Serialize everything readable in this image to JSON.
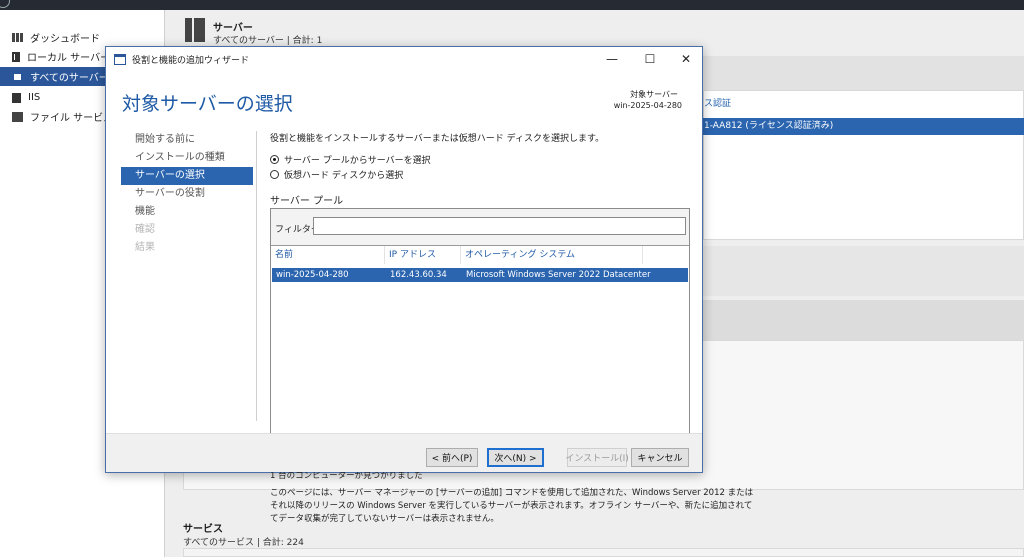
{
  "sidebar": {
    "items": [
      {
        "label": "ダッシュボード",
        "icon": "dashboard-icon"
      },
      {
        "label": "ローカル サーバー",
        "icon": "local-server-icon"
      },
      {
        "label": "すべてのサーバー",
        "icon": "all-servers-icon",
        "active": true
      },
      {
        "label": "IIS",
        "icon": "iis-icon"
      },
      {
        "label": "ファイル サービスと",
        "icon": "file-services-icon"
      }
    ]
  },
  "main": {
    "servers_title": "サーバー",
    "servers_sub": "すべてのサーバー | 合計: 1",
    "activation_link": "ス認証",
    "server_row": "1-AA812 (ライセンス認証済み)",
    "services_title": "サービス",
    "services_sub": "すべてのサービス | 合計: 224"
  },
  "wizard": {
    "window_title": "役割と機能の追加ウィザード",
    "controls": {
      "minimize": "—",
      "maximize": "☐",
      "close": "✕"
    },
    "heading": "対象サーバーの選択",
    "destination_label": "対象サーバー",
    "destination_name": "win-2025-04-280",
    "nav": [
      {
        "label": "開始する前に",
        "state": "normal"
      },
      {
        "label": "インストールの種類",
        "state": "normal"
      },
      {
        "label": "サーバーの選択",
        "state": "active"
      },
      {
        "label": "サーバーの役割",
        "state": "normal"
      },
      {
        "label": "機能",
        "state": "normal"
      },
      {
        "label": "確認",
        "state": "disabled"
      },
      {
        "label": "結果",
        "state": "disabled"
      }
    ],
    "intro": "役割と機能をインストールするサーバーまたは仮想ハード ディスクを選択します。",
    "radio_pool": "サーバー プールからサーバーを選択",
    "radio_vhd": "仮想ハード ディスクから選択",
    "pool_title": "サーバー プール",
    "filter_label": "フィルター:",
    "filter_value": "",
    "columns": {
      "name": "名前",
      "ip": "IP アドレス",
      "os": "オペレーティング システム"
    },
    "rows": [
      {
        "name": "win-2025-04-280",
        "ip": "162.43.60.34",
        "os": "Microsoft Windows Server 2022 Datacenter"
      }
    ],
    "found_text": "1 台のコンピューターが見つかりました",
    "description": [
      "このページには、サーバー マネージャーの [サーバーの追加] コマンドを使用して追加された、Windows Server 2012 または",
      "それ以降のリリースの Windows Server を実行しているサーバーが表示されます。オフライン サーバーや、新たに追加されて",
      "てデータ収集が完了していないサーバーは表示されません。"
    ],
    "buttons": {
      "prev": "< 前へ(P)",
      "next": "次へ(N) >",
      "install": "インストール(I)",
      "cancel": "キャンセル"
    }
  }
}
